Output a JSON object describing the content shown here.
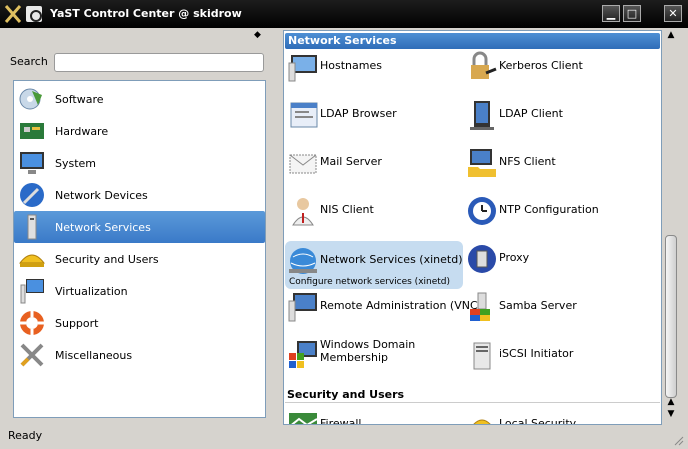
{
  "window": {
    "title": "YaST Control Center @ skidrow",
    "minimize_label": "▁",
    "maximize_label": "□",
    "close_label": "✕"
  },
  "sidebar": {
    "search_label": "Search",
    "search_value": "",
    "items": [
      {
        "label": "Software",
        "icon": "software-icon"
      },
      {
        "label": "Hardware",
        "icon": "hardware-icon"
      },
      {
        "label": "System",
        "icon": "system-icon"
      },
      {
        "label": "Network Devices",
        "icon": "network-devices-icon"
      },
      {
        "label": "Network Services",
        "icon": "network-services-icon",
        "selected": true
      },
      {
        "label": "Security and Users",
        "icon": "security-icon"
      },
      {
        "label": "Virtualization",
        "icon": "virtualization-icon"
      },
      {
        "label": "Support",
        "icon": "support-icon"
      },
      {
        "label": "Miscellaneous",
        "icon": "miscellaneous-icon"
      }
    ]
  },
  "main": {
    "group1_title": "Network Services",
    "group2_title": "Security and Users",
    "modules": [
      {
        "label": "Hostnames",
        "icon": "hostnames-icon"
      },
      {
        "label": "Kerberos Client",
        "icon": "kerberos-icon"
      },
      {
        "label": "LDAP Browser",
        "icon": "ldap-browser-icon"
      },
      {
        "label": "LDAP Client",
        "icon": "ldap-client-icon"
      },
      {
        "label": "Mail Server",
        "icon": "mail-icon"
      },
      {
        "label": "NFS Client",
        "icon": "nfs-icon"
      },
      {
        "label": "NIS Client",
        "icon": "nis-icon"
      },
      {
        "label": "NTP Configuration",
        "icon": "ntp-icon"
      },
      {
        "label": "Network Services (xinetd)",
        "icon": "xinetd-icon",
        "selected": true,
        "description": "Configure network services (xinetd)"
      },
      {
        "label": "Proxy",
        "icon": "proxy-icon"
      },
      {
        "label": "Remote Administration (VNC)",
        "icon": "vnc-icon"
      },
      {
        "label": "Samba Server",
        "icon": "samba-icon"
      },
      {
        "label": "Windows Domain Membership",
        "icon": "windows-domain-icon"
      },
      {
        "label": "iSCSI Initiator",
        "icon": "iscsi-icon"
      },
      {
        "label": "Firewall",
        "icon": "firewall-icon"
      },
      {
        "label": "Local Security",
        "icon": "local-security-icon"
      }
    ]
  },
  "status": {
    "text": "Ready"
  },
  "colors": {
    "selection": "#3a7ac8",
    "group_header": "#2f6db8",
    "module_highlight": "#c6dcf0"
  }
}
